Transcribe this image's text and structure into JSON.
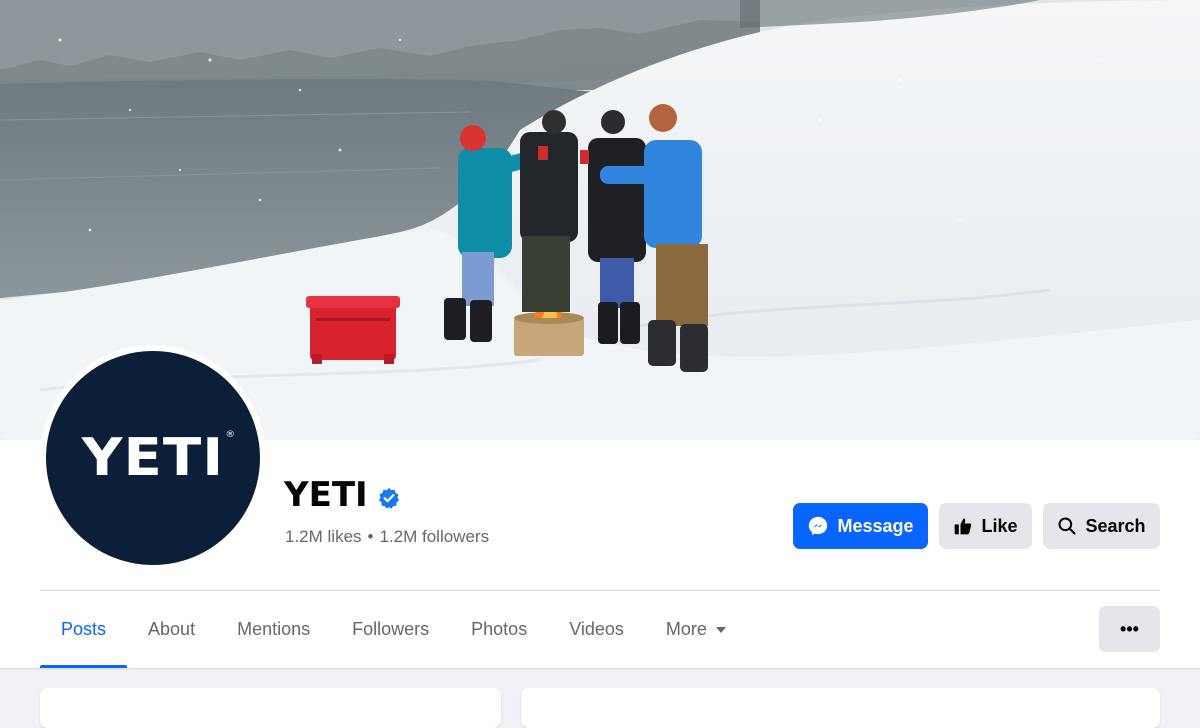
{
  "page": {
    "name": "YETI",
    "verified": true,
    "stats": {
      "likes": "1.2M likes",
      "separator": "•",
      "followers": "1.2M followers"
    },
    "avatar_logo": "YETI",
    "avatar_logo_mark": "®"
  },
  "actions": {
    "message_label": "Message",
    "like_label": "Like",
    "search_label": "Search"
  },
  "tabs": [
    {
      "label": "Posts",
      "active": true
    },
    {
      "label": "About"
    },
    {
      "label": "Mentions"
    },
    {
      "label": "Followers"
    },
    {
      "label": "Photos"
    },
    {
      "label": "Videos"
    },
    {
      "label": "More"
    }
  ],
  "overflow_label": "•••",
  "colors": {
    "accent": "#0866ff",
    "verified_badge": "#1877f2",
    "avatar_bg": "#0b2038",
    "secondary_button": "#e4e6eb",
    "muted_text": "#65676b",
    "page_bg": "#f0f2f5"
  },
  "icons": {
    "message": "messenger-icon",
    "like": "thumbs-up-icon",
    "search": "search-icon",
    "more_tab": "caret-down-icon",
    "overflow": "ellipsis-icon",
    "verified": "verified-badge-icon"
  }
}
